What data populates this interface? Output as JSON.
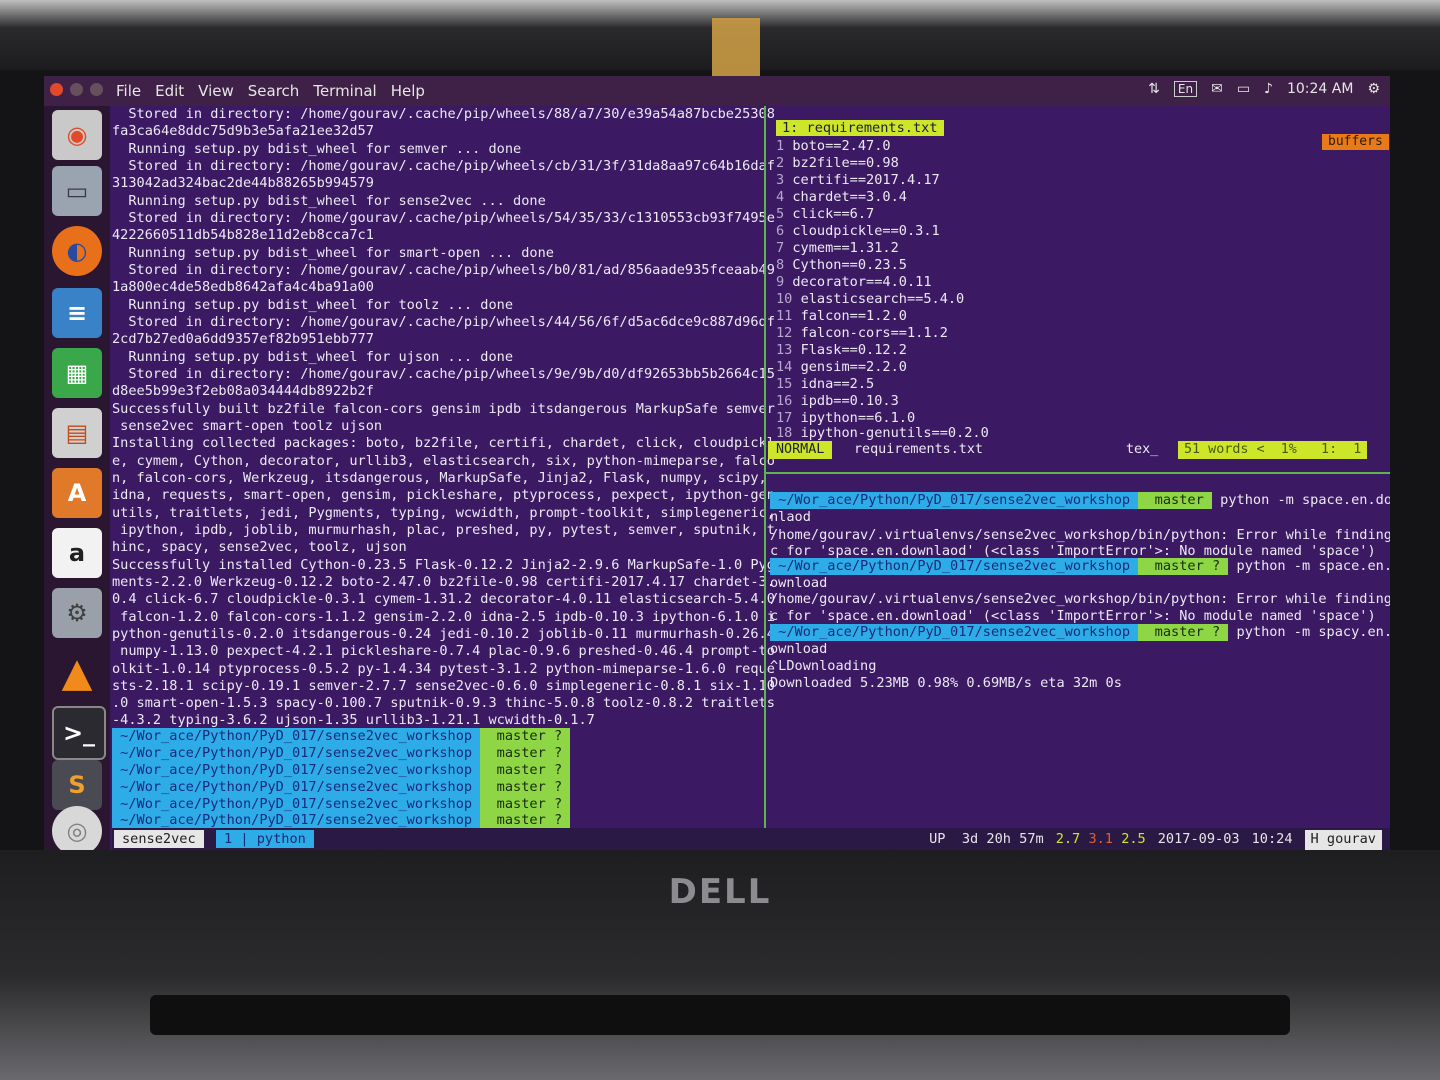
{
  "menubar": {
    "items": [
      "File",
      "Edit",
      "View",
      "Search",
      "Terminal",
      "Help"
    ],
    "keyboard_layout": "En",
    "clock": "10:24 AM"
  },
  "launcher_icons": [
    "ubuntu-dash-icon",
    "files-icon",
    "firefox-icon",
    "writer-icon",
    "calc-icon",
    "impress-icon",
    "software-center-icon",
    "amazon-icon",
    "settings-icon",
    "vlc-icon",
    "terminal-icon",
    "sublime-icon",
    "disc-icon"
  ],
  "left_pane": {
    "lines": [
      "  Stored in directory: /home/gourav/.cache/pip/wheels/88/a7/30/e39a54a87bcbe25308",
      "fa3ca64e8ddc75d9b3e5afa21ee32d57",
      "  Running setup.py bdist_wheel for semver ... done",
      "  Stored in directory: /home/gourav/.cache/pip/wheels/cb/31/3f/31da8aa97c64b16daf",
      "313042ad324bac2de44b88265b994579",
      "  Running setup.py bdist_wheel for sense2vec ... done",
      "  Stored in directory: /home/gourav/.cache/pip/wheels/54/35/33/c1310553cb93f7495e",
      "4222660511db54b828e11d2eb8cca7c1",
      "  Running setup.py bdist_wheel for smart-open ... done",
      "  Stored in directory: /home/gourav/.cache/pip/wheels/b0/81/ad/856aade935fceaab49",
      "1a800ec4de58edb8642afa4c4ba91a00",
      "  Running setup.py bdist_wheel for toolz ... done",
      "  Stored in directory: /home/gourav/.cache/pip/wheels/44/56/6f/d5ac6dce9c887d96df",
      "2cd7b27ed0a6dd9357ef82b951ebb777",
      "  Running setup.py bdist_wheel for ujson ... done",
      "  Stored in directory: /home/gourav/.cache/pip/wheels/9e/9b/d0/df92653bb5b2664c15",
      "d8ee5b99e3f2eb08a034444db8922b2f",
      "Successfully built bz2file falcon-cors gensim ipdb itsdangerous MarkupSafe semver",
      " sense2vec smart-open toolz ujson",
      "Installing collected packages: boto, bz2file, certifi, chardet, click, cloudpickl",
      "e, cymem, Cython, decorator, urllib3, elasticsearch, six, python-mimeparse, falco",
      "n, falcon-cors, Werkzeug, itsdangerous, MarkupSafe, Jinja2, Flask, numpy, scipy,",
      "idna, requests, smart-open, gensim, pickleshare, ptyprocess, pexpect, ipython-gen",
      "utils, traitlets, jedi, Pygments, typing, wcwidth, prompt-toolkit, simplegeneric,",
      " ipython, ipdb, joblib, murmurhash, plac, preshed, py, pytest, semver, sputnik, t",
      "hinc, spacy, sense2vec, toolz, ujson",
      "Successfully installed Cython-0.23.5 Flask-0.12.2 Jinja2-2.9.6 MarkupSafe-1.0 Pyg",
      "ments-2.2.0 Werkzeug-0.12.2 boto-2.47.0 bz2file-0.98 certifi-2017.4.17 chardet-3.",
      "0.4 click-6.7 cloudpickle-0.3.1 cymem-1.31.2 decorator-4.0.11 elasticsearch-5.4.0",
      " falcon-1.2.0 falcon-cors-1.1.2 gensim-2.2.0 idna-2.5 ipdb-0.10.3 ipython-6.1.0 i",
      "python-genutils-0.2.0 itsdangerous-0.24 jedi-0.10.2 joblib-0.11 murmurhash-0.26.4",
      " numpy-1.13.0 pexpect-4.2.1 pickleshare-0.7.4 plac-0.9.6 preshed-0.46.4 prompt-to",
      "olkit-1.0.14 ptyprocess-0.5.2 py-1.4.34 pytest-3.1.2 python-mimeparse-1.6.0 reque",
      "sts-2.18.1 scipy-0.19.1 semver-2.7.7 sense2vec-0.6.0 simplegeneric-0.8.1 six-1.10",
      ".0 smart-open-1.5.3 spacy-0.100.7 sputnik-0.9.3 thinc-5.0.8 toolz-0.8.2 traitlets",
      "-4.3.2 typing-3.6.2 ujson-1.35 urllib3-1.21.1 wcwidth-0.1.7"
    ],
    "prompt_path": " ~/Wor_ace/Python/PyD_017/sense2vec_workshop ",
    "prompt_git": "  master ? "
  },
  "vim": {
    "tab": "1: requirements.txt",
    "buffers_label": "buffers",
    "lines": [
      {
        "n": "1",
        "t": "boto==2.47.0"
      },
      {
        "n": "2",
        "t": "bz2file==0.98"
      },
      {
        "n": "3",
        "t": "certifi==2017.4.17"
      },
      {
        "n": "4",
        "t": "chardet==3.0.4"
      },
      {
        "n": "5",
        "t": "click==6.7"
      },
      {
        "n": "6",
        "t": "cloudpickle==0.3.1"
      },
      {
        "n": "7",
        "t": "cymem==1.31.2"
      },
      {
        "n": "8",
        "t": "Cython==0.23.5"
      },
      {
        "n": "9",
        "t": "decorator==4.0.11"
      },
      {
        "n": "10",
        "t": "elasticsearch==5.4.0"
      },
      {
        "n": "11",
        "t": "falcon==1.2.0"
      },
      {
        "n": "12",
        "t": "falcon-cors==1.1.2"
      },
      {
        "n": "13",
        "t": "Flask==0.12.2"
      },
      {
        "n": "14",
        "t": "gensim==2.2.0"
      },
      {
        "n": "15",
        "t": "idna==2.5"
      },
      {
        "n": "16",
        "t": "ipdb==0.10.3"
      },
      {
        "n": "17",
        "t": "ipython==6.1.0"
      },
      {
        "n": "18",
        "t": "ipython-genutils==0.2.0"
      }
    ],
    "mode": "NORMAL",
    "file": "requirements.txt",
    "filetype": "tex_",
    "position": "51 words <  1%   1:  1"
  },
  "right_pane": {
    "prompt_path": " ~/Wor_ace/Python/PyD_017/sense2vec_workshop ",
    "git_1": "  master ",
    "git_2": "  master ? ",
    "cmd_1": " python -m space.en.dow",
    "cmd_2": " python -m space.en.d",
    "cmd_3": " python -m spacy.en.d",
    "lines": {
      "l1": "nlaod",
      "l2": "/home/gourav/.virtualenvs/sense2vec_workshop/bin/python: Error while finding spe",
      "l3": "c for 'space.en.downlaod' (<class 'ImportError'>: No module named 'space')",
      "l5": "ownload",
      "l6": "/home/gourav/.virtualenvs/sense2vec_workshop/bin/python: Error while finding spe",
      "l7": "c for 'space.en.download' (<class 'ImportError'>: No module named 'space')",
      "l9": "ownload",
      "l10": "^LDownloading",
      "l11": "Downloaded 5.23MB 0.98% 0.69MB/s eta 32m 0s"
    }
  },
  "tmux": {
    "session": "sense2vec",
    "window_index": "1",
    "window_name": "python",
    "uptime": "UP  3d 20h 57m",
    "load_1": "2.7",
    "load_2": "3.1",
    "load_3": "2.5",
    "date": "2017-09-03",
    "time": "10:24",
    "host": "H gourav"
  },
  "brand": "DELL"
}
